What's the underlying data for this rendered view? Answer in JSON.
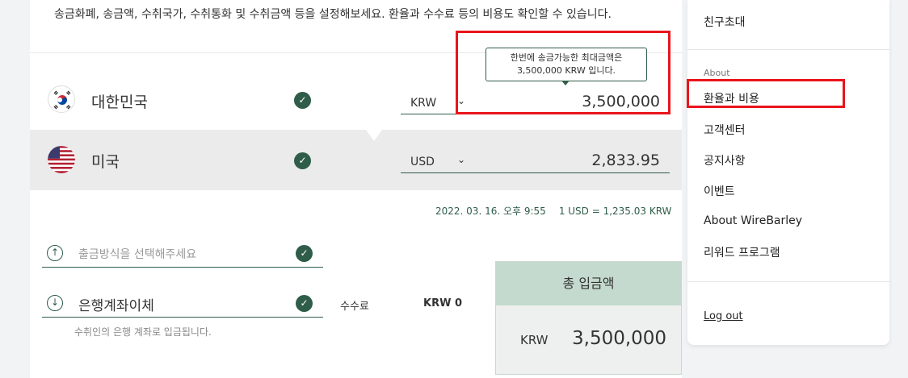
{
  "intro": {
    "description": "송금화폐, 송금액, 수취국가, 수취통화 및 수취금액 등을 설정해보세요. 환율과 수수료 등의 비용도 확인할 수 있습니다."
  },
  "tooltip": {
    "line1": "한번에 송금가능한 최대금액은",
    "line2": "3,500,000 KRW 입니다."
  },
  "send": {
    "country": "대한민국",
    "currency": "KRW",
    "amount": "3,500,000"
  },
  "receive": {
    "country": "미국",
    "currency": "USD",
    "amount": "2,833.95"
  },
  "rate": {
    "datetime": "2022. 03. 16. 오후 9:55",
    "rate_text": "1 USD = 1,235.03 KRW"
  },
  "payout_method": {
    "placeholder": "출금방식을 선택해주세요"
  },
  "deposit_method": {
    "value": "은행계좌이체",
    "note": "수취인의 은행 계좌로 입금됩니다."
  },
  "fee": {
    "label": "수수료",
    "value": "KRW 0"
  },
  "total": {
    "title": "총 입금액",
    "currency": "KRW",
    "amount": "3,500,000"
  },
  "menu": {
    "invite": "친구초대",
    "section_title": "About",
    "items": [
      "환율과 비용",
      "고객센터",
      "공지사항",
      "이벤트",
      "About WireBarley",
      "리워드 프로그램"
    ],
    "logout": "Log out"
  },
  "colors": {
    "accent": "#2f5d4a",
    "highlight": "#e8151b",
    "total_header": "#c5dace"
  }
}
